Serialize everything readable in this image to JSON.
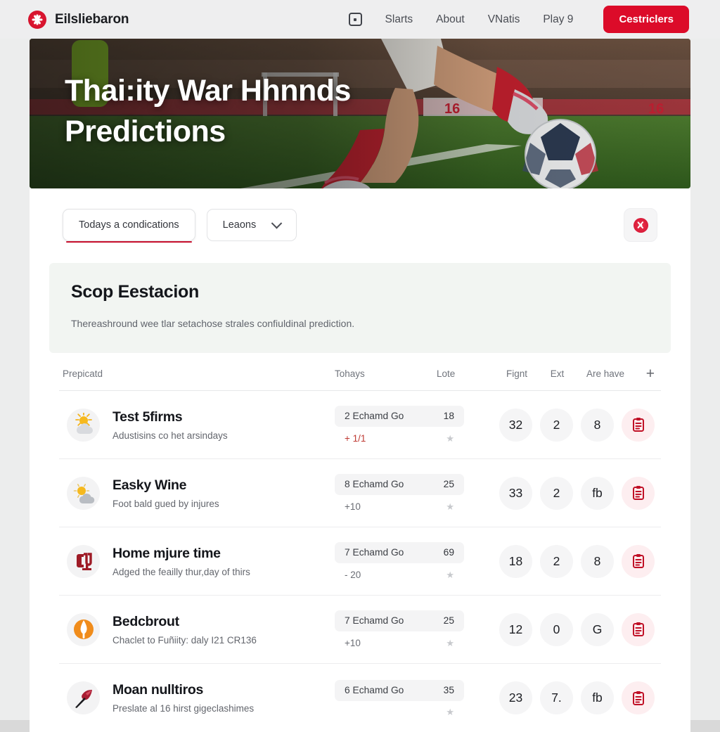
{
  "header": {
    "brand": "Eilsliebaron",
    "brand_icon": "flower-logo-icon",
    "grid_icon": "app-square-icon",
    "nav": [
      {
        "label": "Slarts"
      },
      {
        "label": "About"
      },
      {
        "label": "VNatis"
      },
      {
        "label": "Play 9"
      }
    ],
    "cta_label": "Cestriclers",
    "accent_color": "#dc0b29"
  },
  "hero": {
    "title_line1": "Thai:ity War Hhnnds",
    "title_line2": "Predictions",
    "image_alt": "soccer-player-kicking-ball"
  },
  "tabs": {
    "items": [
      {
        "label": "Todays a condications",
        "active": true
      },
      {
        "label": "Leaons",
        "active": false,
        "has_chevron": true
      }
    ],
    "tool_icon": "flower-logo-icon"
  },
  "notice": {
    "title": "Scop Eestacion",
    "subtitle": "Thereashround wee tlar setachose strales confiuldinal prediction."
  },
  "table": {
    "headers": {
      "prediction": "Prepicatd",
      "todays": "Tohays",
      "lote": "Lote",
      "fignt": "Fignt",
      "ext": "Ext",
      "are_have": "Are have",
      "add": "+"
    },
    "rows": [
      {
        "icon": "sun-behind-cloud-icon",
        "title": "Test 5firms",
        "subtitle": "Adustisins co het arsindays",
        "chip_label": "2 Echamd Go",
        "chip_value": "18",
        "delta": "+ 1/1",
        "delta_sign": "pos",
        "star": "★",
        "fignt": "32",
        "ext": "2",
        "are_have": "8",
        "action_icon": "clipboard-list-icon"
      },
      {
        "icon": "sun-cloud-partial-icon",
        "title": "Easky Wine",
        "subtitle": "Foot bald gued by injures",
        "chip_label": "8 Echamd Go",
        "chip_value": "25",
        "delta": "+10",
        "delta_sign": "neg",
        "star": "★",
        "fignt": "33",
        "ext": "2",
        "are_have": "fb",
        "action_icon": "clipboard-list-icon"
      },
      {
        "icon": "team-crest-cu-icon",
        "title": "Home mjure time",
        "subtitle": "Adged the feailly thur,day of thirs",
        "chip_label": "7 Echamd Go",
        "chip_value": "69",
        "delta": "- 20",
        "delta_sign": "neg",
        "star": "★",
        "fignt": "18",
        "ext": "2",
        "are_have": "8",
        "action_icon": "clipboard-list-icon"
      },
      {
        "icon": "orange-torch-badge-icon",
        "title": "Bedcbrout",
        "subtitle": "Chaclet to Fuñiity: daly I21 CR136",
        "chip_label": "7 Echamd Go",
        "chip_value": "25",
        "delta": "+10",
        "delta_sign": "neg",
        "star": "★",
        "fignt": "12",
        "ext": "0",
        "are_have": "G",
        "action_icon": "clipboard-list-icon"
      },
      {
        "icon": "red-arrow-crest-icon",
        "title": "Moan nulltiros",
        "subtitle": "Preslate al 16 hirst gigeclashimes",
        "chip_label": "6 Echamd Go",
        "chip_value": "35",
        "delta": "",
        "delta_sign": "neg",
        "star": "★",
        "fignt": "23",
        "ext": "7.",
        "are_have": "fb",
        "action_icon": "clipboard-list-icon"
      }
    ]
  }
}
